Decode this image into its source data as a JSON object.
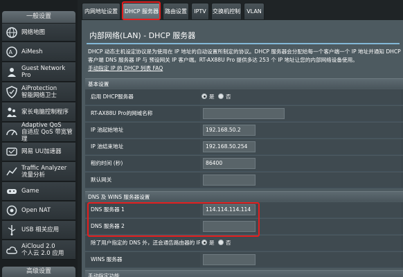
{
  "sidebar": {
    "header": "一般设置",
    "items": [
      {
        "icon": "globe-network-icon",
        "label": "网络地图"
      },
      {
        "icon": "aimesh-icon",
        "label": "AiMesh"
      },
      {
        "icon": "guest-network-icon",
        "label": "Guest Network Pro"
      },
      {
        "icon": "shield-icon",
        "label": "AiProtection\n智能网络卫士"
      },
      {
        "icon": "family-icon",
        "label": "家长电脑控制程序"
      },
      {
        "icon": "speedometer-icon",
        "label": "Adaptive QoS\n自适应 QoS 带宽管理"
      },
      {
        "icon": "vpn-accelerator-icon",
        "label": "网易 UU加速器"
      },
      {
        "icon": "traffic-analyzer-icon",
        "label": "Traffic Analyzer\n流量分析"
      },
      {
        "icon": "gamepad-icon",
        "label": "Game"
      },
      {
        "icon": "open-nat-icon",
        "label": "Open NAT"
      },
      {
        "icon": "usb-icon",
        "label": "USB 相关应用"
      },
      {
        "icon": "cloud-icon",
        "label": "AiCloud 2.0\n个人云 2.0 应用"
      }
    ],
    "footer": "高级设置"
  },
  "tabs": [
    {
      "label": "内网地址设置",
      "active": false
    },
    {
      "label": "DHCP 服务器",
      "active": true
    },
    {
      "label": "路由设置",
      "active": false
    },
    {
      "label": "IPTV",
      "active": false
    },
    {
      "label": "交换机控制",
      "active": false
    },
    {
      "label": "VLAN",
      "active": false
    }
  ],
  "page": {
    "title": "内部网络(LAN) - DHCP 服务器",
    "description": "DHCP 动态主机设定协议是为使用在 IP 地址的自动设置所制定的协议。DHCP 服务器会分配给每一个客户端一个 IP 地址并通知 DHCP 客户端 DNS 服务器 IP 与 预设网关 IP 客户端。RT-AX88U Pro 提供多达 253 个 IP 地址让您的内部网络设备使用。",
    "faq_link": "手动指定 IP 的 DHCP 列表 FAQ"
  },
  "basic": {
    "section": "基本设置",
    "enable_dhcp_label": "启用 DHCP服务器",
    "yes": "是",
    "no": "否",
    "domain_label": "RT-AX88U Pro的网域名称",
    "domain_value": "",
    "start_label": "IP 池起始地址",
    "start_value": "192.168.50.2",
    "end_label": "IP 池结束地址",
    "end_value": "192.168.50.254",
    "lease_label": "租约时间 (秒)",
    "lease_value": "86400",
    "gateway_label": "默认网关",
    "gateway_value": ""
  },
  "dns": {
    "section": "DNS 及 WINS 服务器设置",
    "dns1_label": "DNS 服务器 1",
    "dns1_value": "114.114.114.114",
    "dns2_label": "DNS 服务器 2",
    "dns2_value": "",
    "advertise_label": "除了用户指定的 DNS 外，还会通告路由器的 IP",
    "yes": "是",
    "no": "否",
    "wins_label": "WINS 服务器",
    "wins_value": ""
  },
  "manual": {
    "section": "手动指定功能"
  },
  "colors": {
    "highlight": "#e41e1e",
    "panel": "#4d5a60",
    "rule": "#83b8d7"
  }
}
